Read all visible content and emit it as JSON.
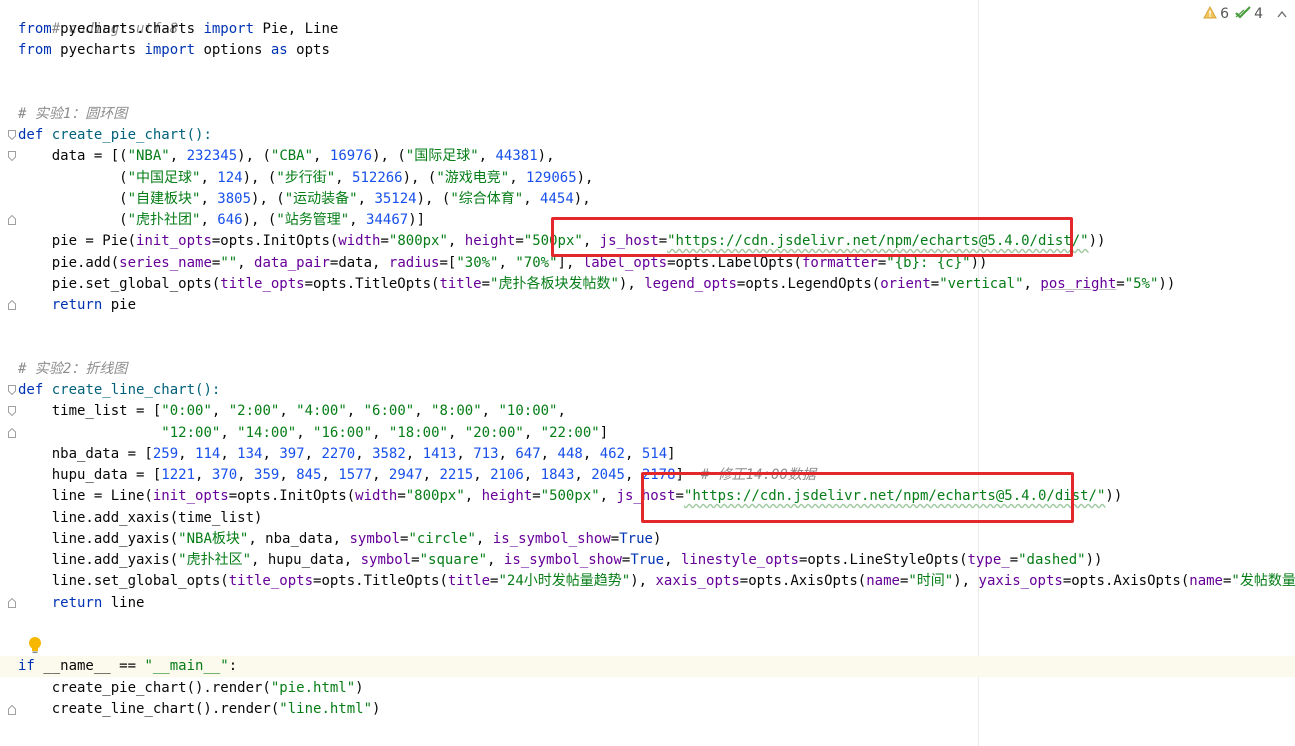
{
  "inspections": {
    "warnings_count": "6",
    "weak_warnings_count": "4"
  },
  "colors": {
    "keyword": "#0033b3",
    "string": "#067d17",
    "number": "#1750eb",
    "comment": "#8c8c8c",
    "param": "#660099",
    "highlight_box": "#e4272b",
    "caret_line": "#fcfaed"
  },
  "icons": [
    "warning-triangle-icon",
    "checkmark-icon",
    "chevron-up-icon",
    "lightbulb-icon",
    "fold-marker-icon"
  ],
  "code": {
    "l1": "# coding: utf-8",
    "l2": {
      "from": "from",
      "mod": " pyecharts.charts ",
      "imp": "import",
      "names": " Pie, Line"
    },
    "l3": {
      "from": "from",
      "mod": " pyecharts ",
      "imp": "import",
      "names": " options ",
      "as": "as",
      "alias": " opts"
    },
    "l6": "# 实验1：圆环图",
    "l7": {
      "def": "def",
      "name": " create_pie_chart():"
    },
    "l8": {
      "a": "    data = [(",
      "s1": "\"NBA\"",
      "b": ", ",
      "n1": "232345",
      "c": "), (",
      "s2": "\"CBA\"",
      "d": ", ",
      "n2": "16976",
      "e": "), (",
      "s3": "\"国际足球\"",
      "f": ", ",
      "n3": "44381",
      "g": "),"
    },
    "l9": {
      "a": "            (",
      "s1": "\"中国足球\"",
      "b": ", ",
      "n1": "124",
      "c": "), (",
      "s2": "\"步行街\"",
      "d": ", ",
      "n2": "512266",
      "e": "), (",
      "s3": "\"游戏电竞\"",
      "f": ", ",
      "n3": "129065",
      "g": "),"
    },
    "l10": {
      "a": "            (",
      "s1": "\"自建板块\"",
      "b": ", ",
      "n1": "3805",
      "c": "), (",
      "s2": "\"运动装备\"",
      "d": ", ",
      "n2": "35124",
      "e": "), (",
      "s3": "\"综合体育\"",
      "f": ", ",
      "n3": "4454",
      "g": "),"
    },
    "l11": {
      "a": "            (",
      "s1": "\"虎扑社团\"",
      "b": ", ",
      "n1": "646",
      "c": "), (",
      "s2": "\"站务管理\"",
      "d": ", ",
      "n2": "34467",
      "g": ")]"
    },
    "l12": {
      "a": "    pie = Pie(",
      "p1": "init_opts",
      "b": "=opts.InitOpts(",
      "p2": "width",
      "c": "=",
      "s1": "\"800px\"",
      "d": ", ",
      "p3": "height",
      "e": "=",
      "s2": "\"500px\"",
      "f": ", ",
      "p4": "js_host",
      "g": "=",
      "s3": "\"https://cdn.jsdelivr.net/npm/echarts@5.4.0/dist/\"",
      "h": "))"
    },
    "l13": {
      "a": "    pie.add(",
      "p1": "series_name",
      "b": "=",
      "s1": "\"\"",
      "c": ", ",
      "p2": "data_pair",
      "d": "=data, ",
      "p3": "radius",
      "e": "=[",
      "s2": "\"30%\"",
      "f": ", ",
      "s3": "\"70%\"",
      "g": "], ",
      "p4": "label_opts",
      "h": "=opts.LabelOpts(",
      "p5": "formatter",
      "i": "=",
      "s4": "\"{b}: {c}\"",
      "j": "))"
    },
    "l14": {
      "a": "    pie.set_global_opts(",
      "p1": "title_opts",
      "b": "=opts.TitleOpts(",
      "p2": "title",
      "c": "=",
      "s1": "\"虎扑各板块发帖数\"",
      "d": "), ",
      "p3": "legend_opts",
      "e": "=opts.LegendOpts(",
      "p4": "orient",
      "f": "=",
      "s2": "\"vertical\"",
      "g": ", ",
      "p5": "pos_right",
      "h": "=",
      "s3": "\"5%\"",
      "i": "))"
    },
    "l15": {
      "ret": "    return",
      "v": " pie"
    },
    "l18": "# 实验2：折线图",
    "l19": {
      "def": "def",
      "name": " create_line_chart():"
    },
    "l20": {
      "a": "    time_list = [",
      "s1": "\"0:00\"",
      "s2": "\"2:00\"",
      "s3": "\"4:00\"",
      "s4": "\"6:00\"",
      "s5": "\"8:00\"",
      "s6": "\"10:00\""
    },
    "l21": {
      "a": "                 ",
      "s1": "\"12:00\"",
      "s2": "\"14:00\"",
      "s3": "\"16:00\"",
      "s4": "\"18:00\"",
      "s5": "\"20:00\"",
      "s6": "\"22:00\"",
      "z": "]"
    },
    "l22": {
      "a": "    nba_data = [",
      "nums": [
        "259",
        "114",
        "134",
        "397",
        "2270",
        "3582",
        "1413",
        "713",
        "647",
        "448",
        "462",
        "514"
      ],
      "z": "]"
    },
    "l23": {
      "a": "    hupu_data = [",
      "nums": [
        "1221",
        "370",
        "359",
        "845",
        "1577",
        "2947",
        "2215",
        "2106",
        "1843",
        "2045",
        "2178"
      ],
      "z": "]",
      "cmt": "  # 修正14:00数据"
    },
    "l24": {
      "a": "    line = Line(",
      "p1": "init_opts",
      "b": "=opts.InitOpts(",
      "p2": "width",
      "c": "=",
      "s1": "\"800px\"",
      "d": ", ",
      "p3": "height",
      "e": "=",
      "s2": "\"500px\"",
      "f": ", ",
      "p4": "js_host",
      "g": "=",
      "s3": "\"https://cdn.jsdelivr.net/npm/echarts@5.4.0/dist/\"",
      "h": "))"
    },
    "l25": "    line.add_xaxis(time_list)",
    "l26": {
      "a": "    line.add_yaxis(",
      "s1": "\"NBA板块\"",
      "b": ", nba_data, ",
      "p1": "symbol",
      "c": "=",
      "s2": "\"circle\"",
      "d": ", ",
      "p2": "is_symbol_show",
      "e": "=",
      "k": "True",
      "f": ")"
    },
    "l27": {
      "a": "    line.add_yaxis(",
      "s1": "\"虎扑社区\"",
      "b": ", hupu_data, ",
      "p1": "symbol",
      "c": "=",
      "s2": "\"square\"",
      "d": ", ",
      "p2": "is_symbol_show",
      "e": "=",
      "k": "True",
      "f": ", ",
      "p3": "linestyle_opts",
      "g": "=opts.LineStyleOpts(",
      "p4": "type_",
      "h": "=",
      "s3": "\"dashed\"",
      "i": "))"
    },
    "l28": {
      "a": "    line.set_global_opts(",
      "p1": "title_opts",
      "b": "=opts.TitleOpts(",
      "p2": "title",
      "c": "=",
      "s1": "\"24小时发帖量趋势\"",
      "d": "), ",
      "p3": "xaxis_opts",
      "e": "=opts.AxisOpts(",
      "p4": "name",
      "f": "=",
      "s2": "\"时间\"",
      "g": "), ",
      "p5": "yaxis_opts",
      "h": "=opts.AxisOpts(",
      "p6": "name",
      "i": "=",
      "s3": "\"发帖数量\"",
      "j": "))"
    },
    "l29": {
      "ret": "    return",
      "v": " line"
    },
    "l32": {
      "if": "if",
      "a": " __name__ == ",
      "s1": "\"__main__\"",
      "b": ":"
    },
    "l33": {
      "a": "    create_pie_chart().render(",
      "s1": "\"pie.html\"",
      "b": ")"
    },
    "l34": {
      "a": "    create_line_chart().render(",
      "s1": "\"line.html\"",
      "b": ")"
    }
  }
}
